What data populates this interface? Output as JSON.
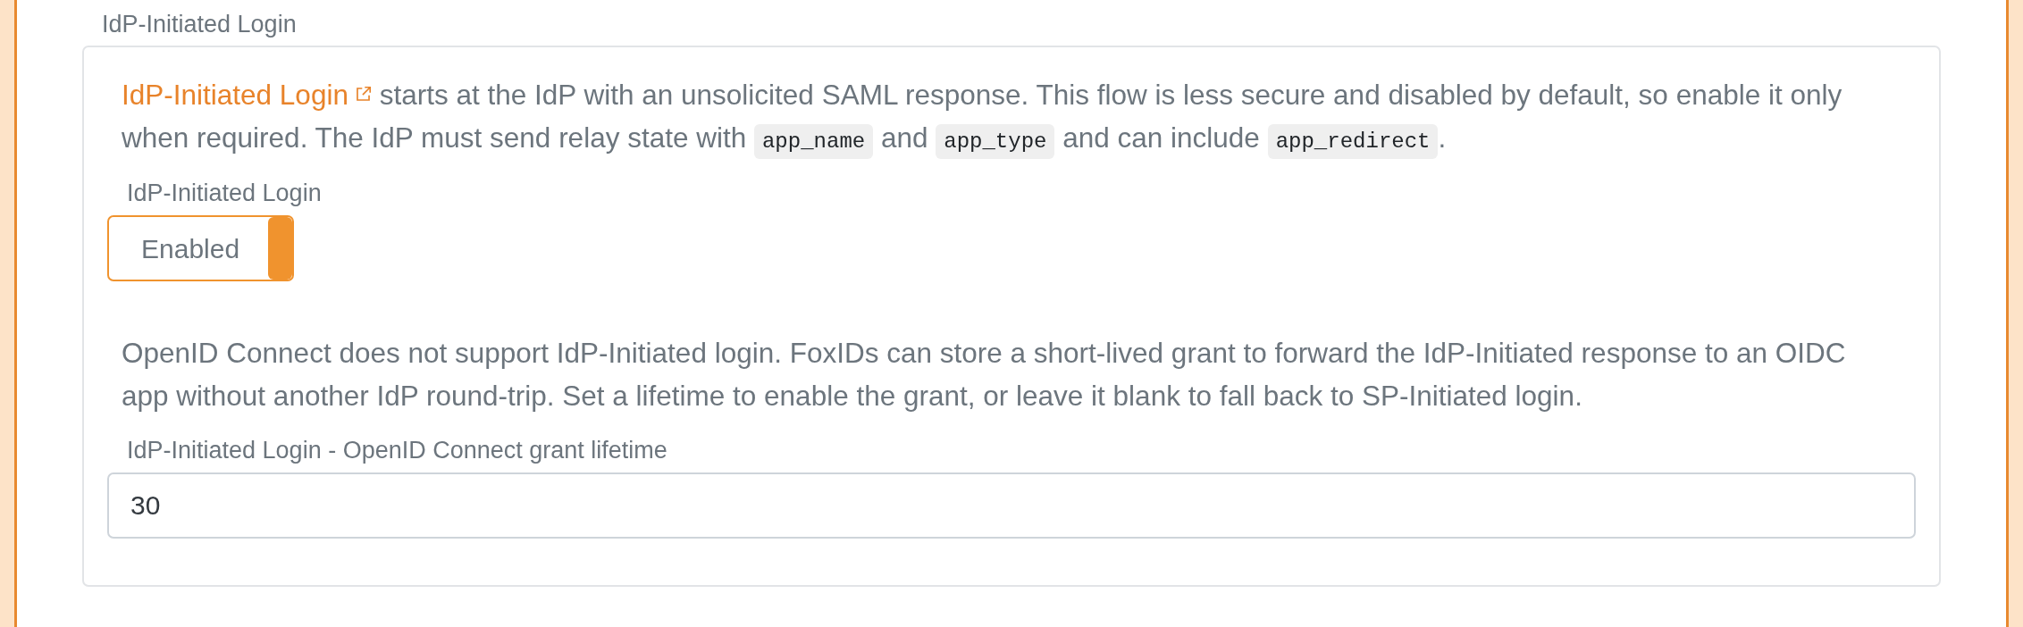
{
  "panel": {
    "title": "IdP-Initiated Login",
    "intro": [
      {
        "kind": "link",
        "text": "IdP-Initiated Login"
      },
      {
        "kind": "text",
        "text": " starts at the IdP with an unsolicited SAML response. This flow is less secure and disabled by default, so enable it only when required. The IdP must send relay state with "
      },
      {
        "kind": "code",
        "text": "app_name"
      },
      {
        "kind": "text",
        "text": " and "
      },
      {
        "kind": "code",
        "text": "app_type"
      },
      {
        "kind": "text",
        "text": " and can include "
      },
      {
        "kind": "code",
        "text": "app_redirect"
      },
      {
        "kind": "text",
        "text": "."
      }
    ],
    "toggle": {
      "label": "IdP-Initiated Login",
      "value": "Enabled",
      "on": true
    },
    "note": "OpenID Connect does not support IdP-Initiated login. FoxIDs can store a short-lived grant to forward the IdP-Initiated response to an OIDC app without another IdP round-trip. Set a lifetime to enable the grant, or leave it blank to fall back to SP-Initiated login.",
    "lifetime_field": {
      "label": "IdP-Initiated Login - OpenID Connect grant lifetime",
      "value": "30"
    }
  }
}
